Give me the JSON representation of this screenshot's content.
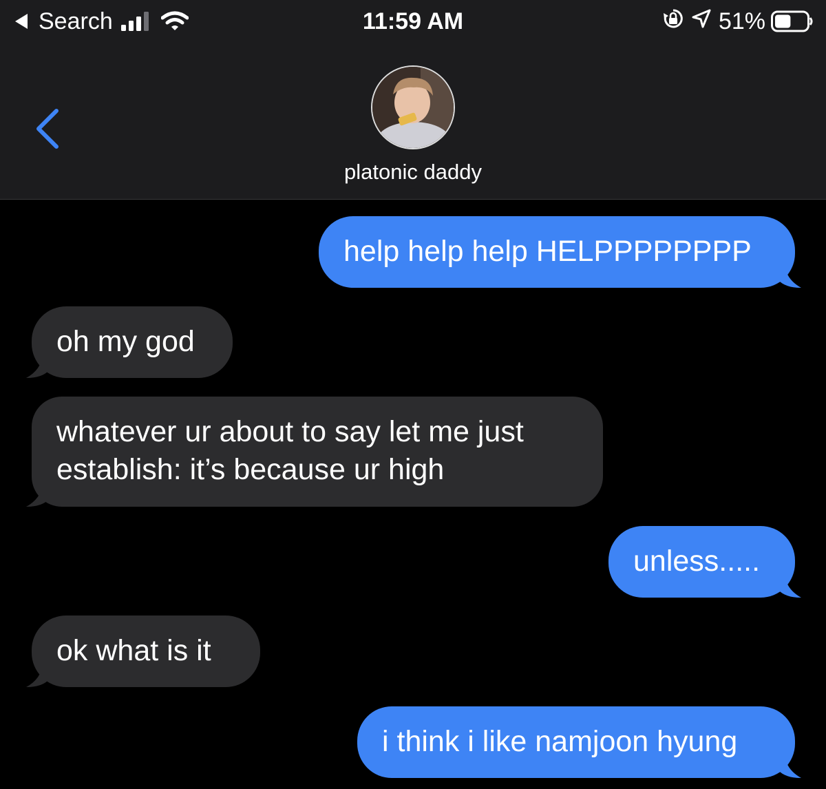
{
  "status_bar": {
    "back_app": "Search",
    "time": "11:59 AM",
    "battery_percent": "51%",
    "battery_level": 0.51
  },
  "header": {
    "contact_name": "platonic daddy"
  },
  "messages": [
    {
      "side": "sent",
      "text": "help help help HELPPPPPPPP"
    },
    {
      "side": "received",
      "text": "oh my god"
    },
    {
      "side": "received",
      "line1": "whatever ur about to say let me just",
      "line2": "establish: it’s because ur high"
    },
    {
      "side": "sent",
      "text": "unless....."
    },
    {
      "side": "received",
      "text": "ok what is it"
    },
    {
      "side": "sent",
      "text": "i think i like namjoon hyung"
    }
  ],
  "colors": {
    "sent_bubble": "#3e84f5",
    "received_bubble": "#2c2c2e",
    "header_bg": "#1c1c1e",
    "accent": "#3e84f5"
  }
}
